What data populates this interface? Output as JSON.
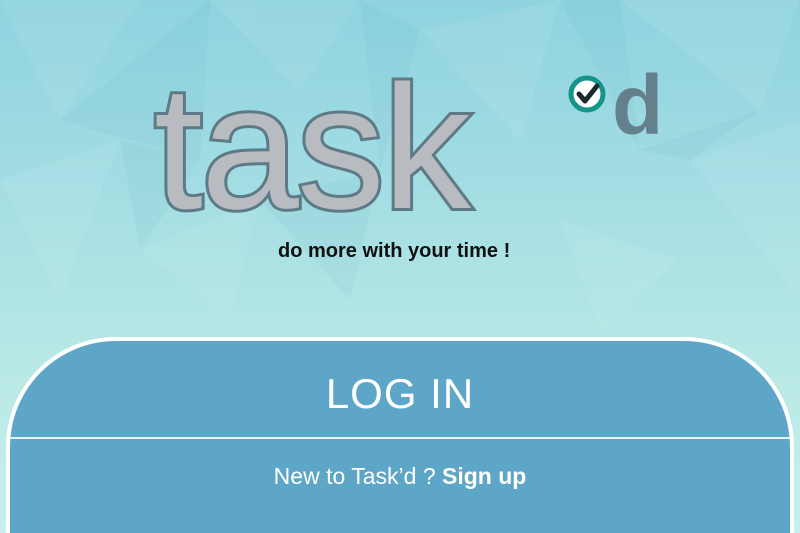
{
  "brand": {
    "logo_text": "task",
    "logo_suffix": "d",
    "tagline": "do more with your time !"
  },
  "login": {
    "button_label": "LOG IN"
  },
  "signup": {
    "prompt": "New to Task’d ?",
    "link_label": "Sign up"
  },
  "icons": {
    "check": "check-circle-icon"
  },
  "colors": {
    "background_top": "#8fd3df",
    "background_bottom": "#c8efe9",
    "panel": "#5ea6c7",
    "logo_fill": "#b8bcc0",
    "logo_outline": "#5e7a86",
    "logo_suffix": "#64808c",
    "check_accent": "#15958a",
    "text_white": "#ffffff"
  }
}
